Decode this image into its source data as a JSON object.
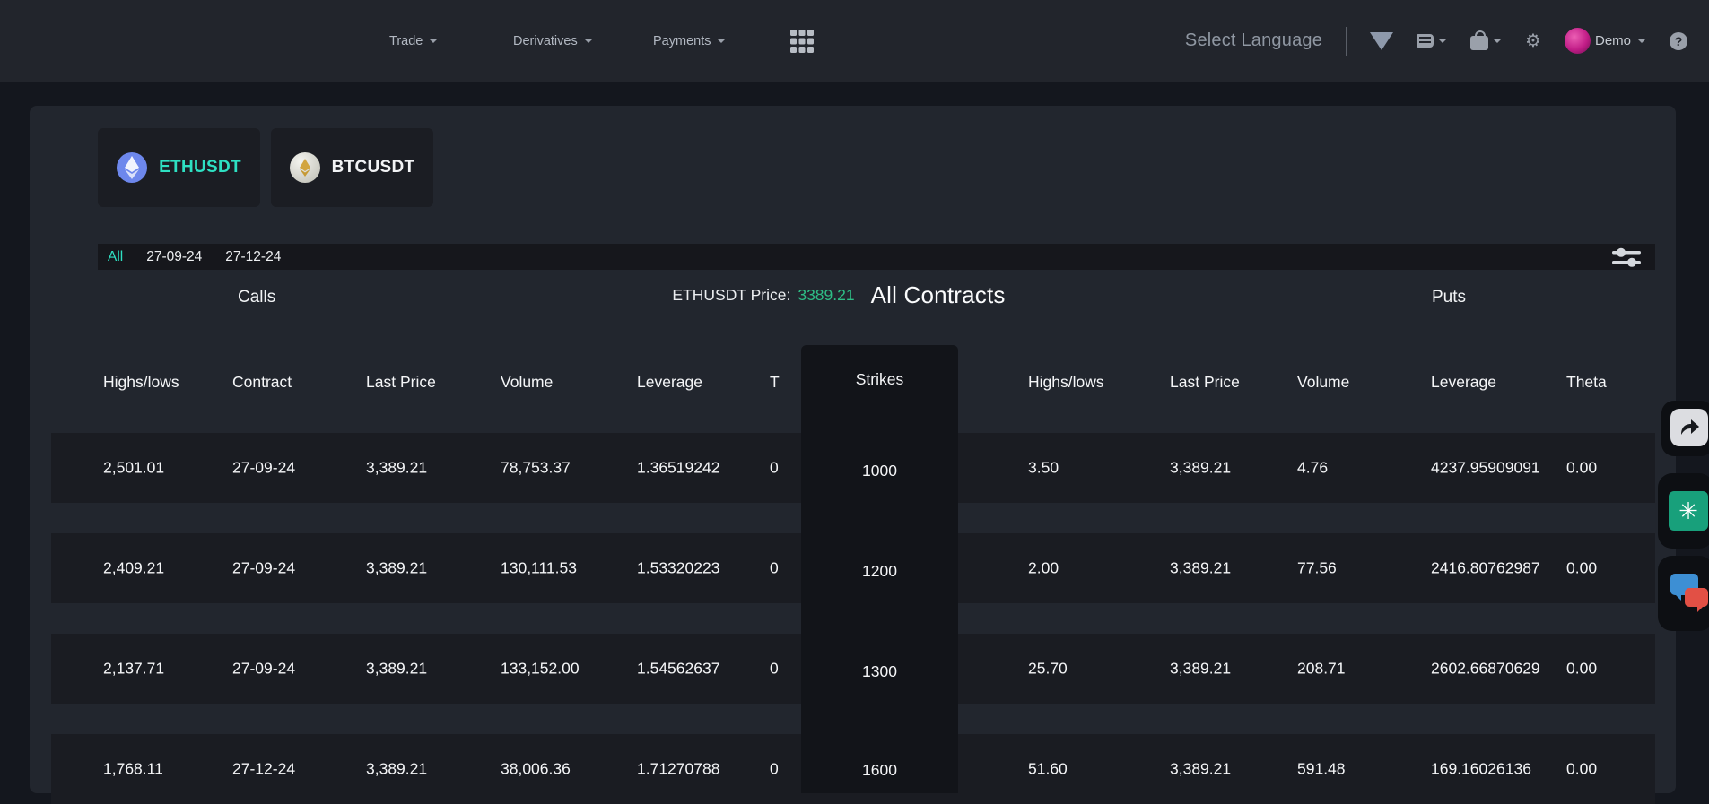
{
  "header": {
    "nav": [
      {
        "label": "Trade"
      },
      {
        "label": "Derivatives"
      },
      {
        "label": "Payments"
      }
    ],
    "language_label": "Select Language",
    "user_name": "Demo"
  },
  "pairs": [
    {
      "symbol": "ETHUSDT",
      "active": true
    },
    {
      "symbol": "BTCUSDT",
      "active": false
    }
  ],
  "expiry_tabs": [
    {
      "label": "All",
      "active": true
    },
    {
      "label": "27-09-24",
      "active": false
    },
    {
      "label": "27-12-24",
      "active": false
    }
  ],
  "section": {
    "calls_title": "Calls",
    "puts_title": "Puts",
    "price_label": "ETHUSDT Price:",
    "price_value": "3389.21",
    "contracts_title": "All Contracts"
  },
  "table": {
    "calls_headers": [
      "Highs/lows",
      "Contract",
      "Last Price",
      "Volume",
      "Leverage",
      "T"
    ],
    "strikes_header": "Strikes",
    "puts_headers": [
      "Highs/lows",
      "Last Price",
      "Volume",
      "Leverage",
      "Theta"
    ],
    "rows": [
      {
        "calls": [
          "2,501.01",
          "27-09-24",
          "3,389.21",
          "78,753.37",
          "1.36519242",
          "0"
        ],
        "strike": "1000",
        "puts": [
          "3.50",
          "3,389.21",
          "4.76",
          "4237.95909091",
          "0.00"
        ]
      },
      {
        "calls": [
          "2,409.21",
          "27-09-24",
          "3,389.21",
          "130,111.53",
          "1.53320223",
          "0"
        ],
        "strike": "1200",
        "puts": [
          "2.00",
          "3,389.21",
          "77.56",
          "2416.80762987",
          "0.00"
        ]
      },
      {
        "calls": [
          "2,137.71",
          "27-09-24",
          "3,389.21",
          "133,152.00",
          "1.54562637",
          "0"
        ],
        "strike": "1300",
        "puts": [
          "25.70",
          "3,389.21",
          "208.71",
          "2602.66870629",
          "0.00"
        ]
      },
      {
        "calls": [
          "1,768.11",
          "27-12-24",
          "3,389.21",
          "38,006.36",
          "1.71270788",
          "0"
        ],
        "strike": "1600",
        "puts": [
          "51.60",
          "3,389.21",
          "591.48",
          "169.16026136",
          "0.00"
        ]
      }
    ]
  },
  "colors": {
    "accent_teal": "#2ee0c2",
    "price_green": "#2ebd85",
    "header_bg": "#22252c",
    "panel_bg": "#22262e",
    "row_bg": "#1a1c22",
    "strikes_bg": "#121419",
    "chatgpt_green": "#18a07b"
  },
  "icons": {
    "apps_grid": "3x3-dot-grid",
    "language_triangle": "filled-down-triangle",
    "orderbook": "book",
    "wallet": "wallet-with-clasp",
    "settings": "gear",
    "help": "question-circle",
    "filter": "tune-sliders",
    "share": "curved-arrow",
    "chatgpt": "openai-flower",
    "chat_widget": "dual-chat-bubbles",
    "eth": "ethereum-diamond",
    "btc": "gold-diamond-coin"
  }
}
